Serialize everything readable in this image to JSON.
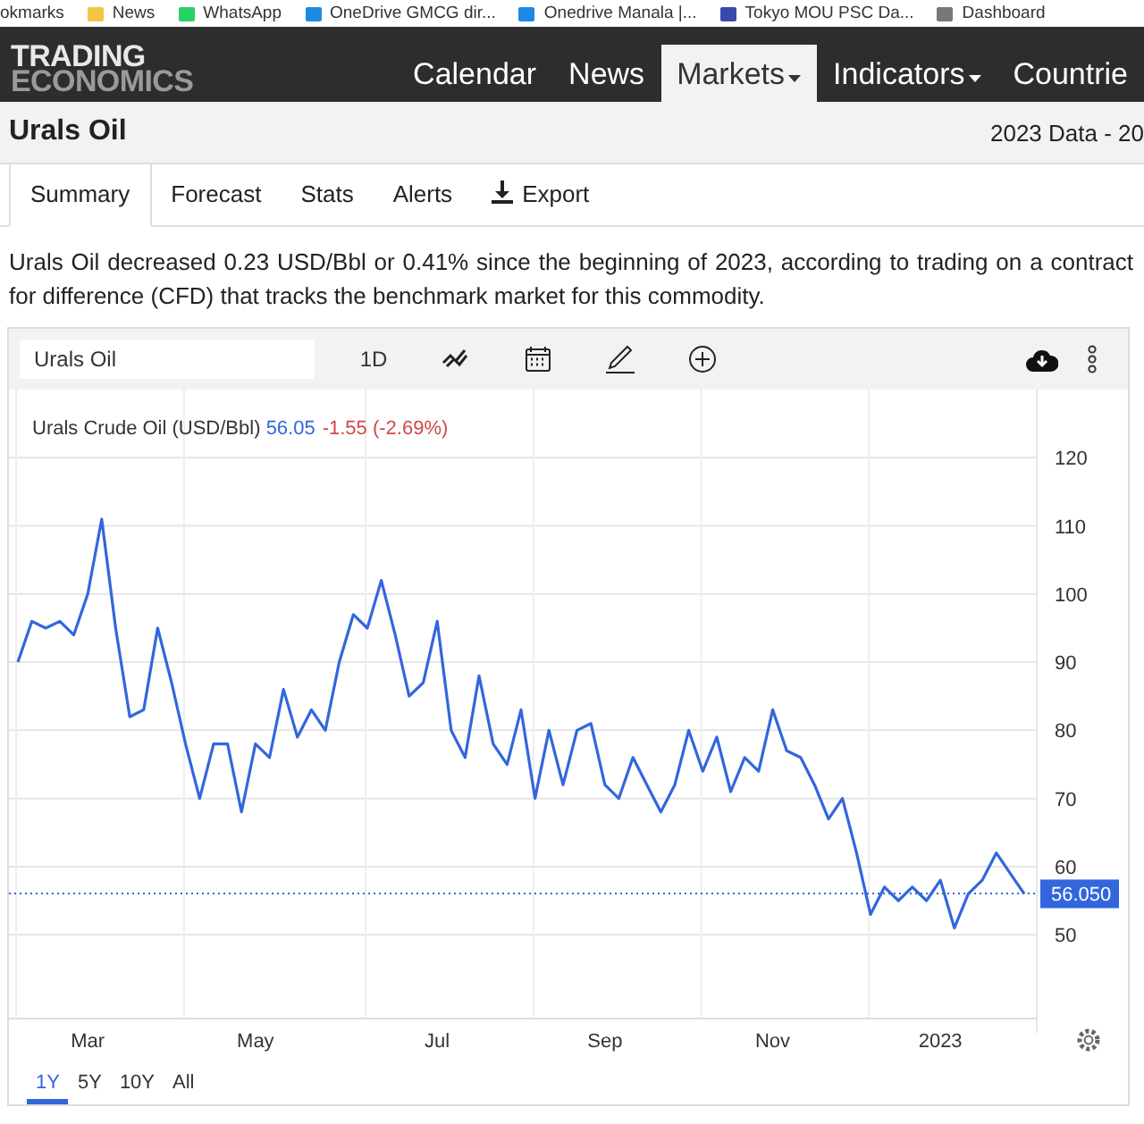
{
  "bookmarks": [
    {
      "label": "okmarks"
    },
    {
      "label": "News"
    },
    {
      "label": "WhatsApp"
    },
    {
      "label": "OneDrive GMCG dir..."
    },
    {
      "label": "Onedrive Manala |..."
    },
    {
      "label": "Tokyo MOU PSC Da..."
    },
    {
      "label": "Dashboard"
    }
  ],
  "header": {
    "logo_top": "TRADING",
    "logo_bottom": "ECONOMICS",
    "nav": [
      {
        "label": "Calendar",
        "selected": false,
        "dropdown": false
      },
      {
        "label": "News",
        "selected": false,
        "dropdown": false
      },
      {
        "label": "Markets",
        "selected": true,
        "dropdown": true
      },
      {
        "label": "Indicators",
        "selected": false,
        "dropdown": true
      },
      {
        "label": "Countrie",
        "selected": false,
        "dropdown": false
      }
    ]
  },
  "page": {
    "title": "Urals Oil",
    "data_range": "2023 Data - 20"
  },
  "tabs": [
    {
      "label": "Summary",
      "selected": true
    },
    {
      "label": "Forecast",
      "selected": false
    },
    {
      "label": "Stats",
      "selected": false
    },
    {
      "label": "Alerts",
      "selected": false
    },
    {
      "label": "Export",
      "selected": false
    }
  ],
  "summary": "Urals Oil decreased 0.23 USD/Bbl or 0.41% since the beginning of 2023, according to trading on a contract for difference (CFD) that tracks the benchmark market for this commodity.",
  "chart_panel": {
    "symbol_field": "Urals Oil",
    "interval": "1D",
    "legend_value": "56.05",
    "legend_change": "-1.55 (-2.69%)",
    "last_label": "56.050",
    "chart_data": {
      "type": "line",
      "categories": [
        null,
        null,
        null,
        null,
        null,
        "Mar",
        null,
        null,
        null,
        null,
        null,
        null,
        null,
        null,
        null,
        null,
        null,
        "May",
        null,
        null,
        null,
        null,
        null,
        null,
        null,
        null,
        null,
        null,
        null,
        null,
        "Jul",
        null,
        null,
        null,
        null,
        null,
        null,
        null,
        null,
        null,
        null,
        null,
        "Sep",
        null,
        null,
        null,
        null,
        null,
        null,
        null,
        null,
        null,
        null,
        null,
        "Nov",
        null,
        null,
        null,
        null,
        null,
        null,
        null,
        null,
        null,
        null,
        null,
        "2023",
        null,
        null,
        null,
        null,
        null,
        null
      ],
      "series": [
        {
          "name": "Urals Crude Oil (USD/Bbl)",
          "color": "#3366dd",
          "values": [
            90,
            96,
            95,
            96,
            94,
            100,
            111,
            95,
            82,
            83,
            95,
            87,
            78,
            70,
            78,
            78,
            68,
            78,
            76,
            86,
            79,
            83,
            80,
            90,
            97,
            95,
            102,
            94,
            85,
            87,
            96,
            80,
            76,
            88,
            78,
            75,
            83,
            70,
            80,
            72,
            80,
            81,
            72,
            70,
            76,
            72,
            68,
            72,
            80,
            74,
            79,
            71,
            76,
            74,
            83,
            77,
            76,
            72,
            67,
            70,
            62,
            53,
            57,
            55,
            57,
            55,
            58,
            51,
            56,
            58,
            62,
            59,
            56
          ]
        }
      ],
      "ylim": [
        37.7,
        130
      ],
      "grid": true,
      "ref_lines": [
        {
          "value": 56.05,
          "axis": "y",
          "color": "#3366dd"
        }
      ],
      "yticks": [
        50,
        60,
        70,
        80,
        90,
        100,
        110,
        120
      ]
    },
    "ranges": [
      {
        "label": "1Y",
        "selected": true
      },
      {
        "label": "5Y",
        "selected": false
      },
      {
        "label": "10Y",
        "selected": false
      },
      {
        "label": "All",
        "selected": false
      }
    ]
  }
}
